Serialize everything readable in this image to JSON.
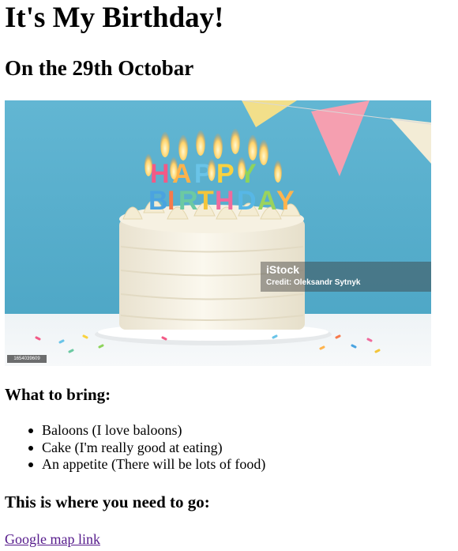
{
  "heading": "It's My Birthday!",
  "date_line": "On the 29th Octobar",
  "image": {
    "logo": "iStock",
    "credit": "Credit: Oleksandr Sytnyk",
    "stock_id": "1654039609",
    "alt": "birthday-cake-photo"
  },
  "bring": {
    "heading": "What to bring:",
    "items": [
      "Baloons (I love baloons)",
      "Cake (I'm really good at eating)",
      "An appetite (There will be lots of food)"
    ]
  },
  "directions": {
    "heading": "This is where you need to go:",
    "link_text": "Google map link"
  },
  "colors": {
    "link_visited": "#551a8b",
    "photo_background": "#5fb3d0"
  }
}
